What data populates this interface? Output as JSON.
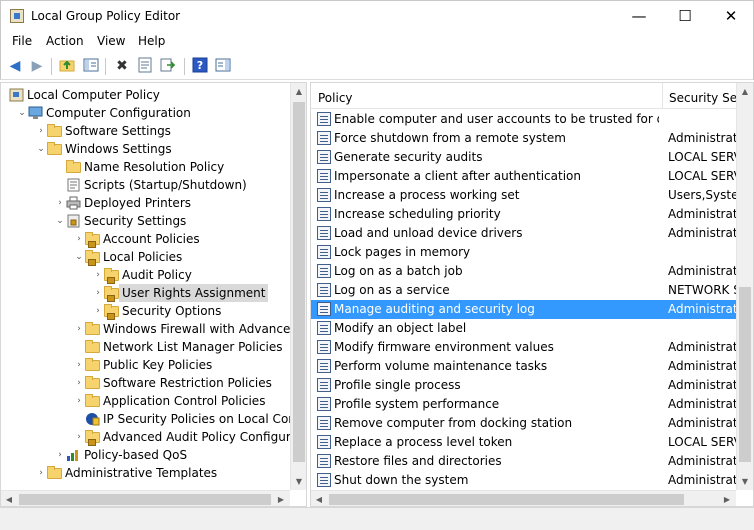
{
  "window": {
    "title": "Local Group Policy Editor",
    "minimize": "—",
    "maximize": "☐",
    "close": "✕"
  },
  "menu": [
    "File",
    "Action",
    "View",
    "Help"
  ],
  "toolbar": [
    "back-arrow-icon",
    "forward-arrow-icon",
    "up-folder-icon",
    "show-hide-tree-icon",
    "delete-icon",
    "properties-icon",
    "export-list-icon",
    "help-icon",
    "show-action-pane-icon"
  ],
  "tree": [
    {
      "label": "Local Computer Policy",
      "level": 0,
      "icon": "policy",
      "expander": ""
    },
    {
      "label": "Computer Configuration",
      "level": 1,
      "icon": "computer",
      "expander": "⌄"
    },
    {
      "label": "Software Settings",
      "level": 2,
      "icon": "folder",
      "expander": "›"
    },
    {
      "label": "Windows Settings",
      "level": 2,
      "icon": "folder",
      "expander": "⌄"
    },
    {
      "label": "Name Resolution Policy",
      "level": 3,
      "icon": "folder",
      "expander": ""
    },
    {
      "label": "Scripts (Startup/Shutdown)",
      "level": 3,
      "icon": "script",
      "expander": ""
    },
    {
      "label": "Deployed Printers",
      "level": 3,
      "icon": "printer",
      "expander": "›"
    },
    {
      "label": "Security Settings",
      "level": 3,
      "icon": "security",
      "expander": "⌄"
    },
    {
      "label": "Account Policies",
      "level": 4,
      "icon": "lockfolder",
      "expander": "›"
    },
    {
      "label": "Local Policies",
      "level": 4,
      "icon": "lockfolder",
      "expander": "⌄"
    },
    {
      "label": "Audit Policy",
      "level": 5,
      "icon": "lockfolder",
      "expander": "›"
    },
    {
      "label": "User Rights Assignment",
      "level": 5,
      "icon": "lockfolder",
      "expander": "›",
      "selected": true
    },
    {
      "label": "Security Options",
      "level": 5,
      "icon": "lockfolder",
      "expander": "›"
    },
    {
      "label": "Windows Firewall with Advanced Se",
      "level": 4,
      "icon": "folder",
      "expander": "›"
    },
    {
      "label": "Network List Manager Policies",
      "level": 4,
      "icon": "folder",
      "expander": ""
    },
    {
      "label": "Public Key Policies",
      "level": 4,
      "icon": "folder",
      "expander": "›"
    },
    {
      "label": "Software Restriction Policies",
      "level": 4,
      "icon": "folder",
      "expander": "›"
    },
    {
      "label": "Application Control Policies",
      "level": 4,
      "icon": "folder",
      "expander": "›"
    },
    {
      "label": "IP Security Policies on Local Compu",
      "level": 4,
      "icon": "ipsec",
      "expander": ""
    },
    {
      "label": "Advanced Audit Policy Configuratio",
      "level": 4,
      "icon": "lockfolder",
      "expander": "›"
    },
    {
      "label": "Policy-based QoS",
      "level": 3,
      "icon": "qos",
      "expander": "›"
    },
    {
      "label": "Administrative Templates",
      "level": 2,
      "icon": "folder",
      "expander": "›"
    }
  ],
  "list": {
    "columns": [
      "Policy",
      "Security Sett"
    ],
    "sort_indicator": "ˆ",
    "rows": [
      {
        "policy": "Enable computer and user accounts to be trusted for delega...",
        "setting": ""
      },
      {
        "policy": "Force shutdown from a remote system",
        "setting": "Administrat"
      },
      {
        "policy": "Generate security audits",
        "setting": "LOCAL SERV"
      },
      {
        "policy": "Impersonate a client after authentication",
        "setting": "LOCAL SERV"
      },
      {
        "policy": "Increase a process working set",
        "setting": "Users,System"
      },
      {
        "policy": "Increase scheduling priority",
        "setting": "Administrat"
      },
      {
        "policy": "Load and unload device drivers",
        "setting": "Administrat"
      },
      {
        "policy": "Lock pages in memory",
        "setting": ""
      },
      {
        "policy": "Log on as a batch job",
        "setting": "Administrat"
      },
      {
        "policy": "Log on as a service",
        "setting": "NETWORK S"
      },
      {
        "policy": "Manage auditing and security log",
        "setting": "Administrat",
        "selected": true
      },
      {
        "policy": "Modify an object label",
        "setting": ""
      },
      {
        "policy": "Modify firmware environment values",
        "setting": "Administrat"
      },
      {
        "policy": "Perform volume maintenance tasks",
        "setting": "Administrat"
      },
      {
        "policy": "Profile single process",
        "setting": "Administrat"
      },
      {
        "policy": "Profile system performance",
        "setting": "Administrat"
      },
      {
        "policy": "Remove computer from docking station",
        "setting": "Administrat"
      },
      {
        "policy": "Replace a process level token",
        "setting": "LOCAL SERV"
      },
      {
        "policy": "Restore files and directories",
        "setting": "Administrat"
      },
      {
        "policy": "Shut down the system",
        "setting": "Administrat"
      }
    ]
  }
}
